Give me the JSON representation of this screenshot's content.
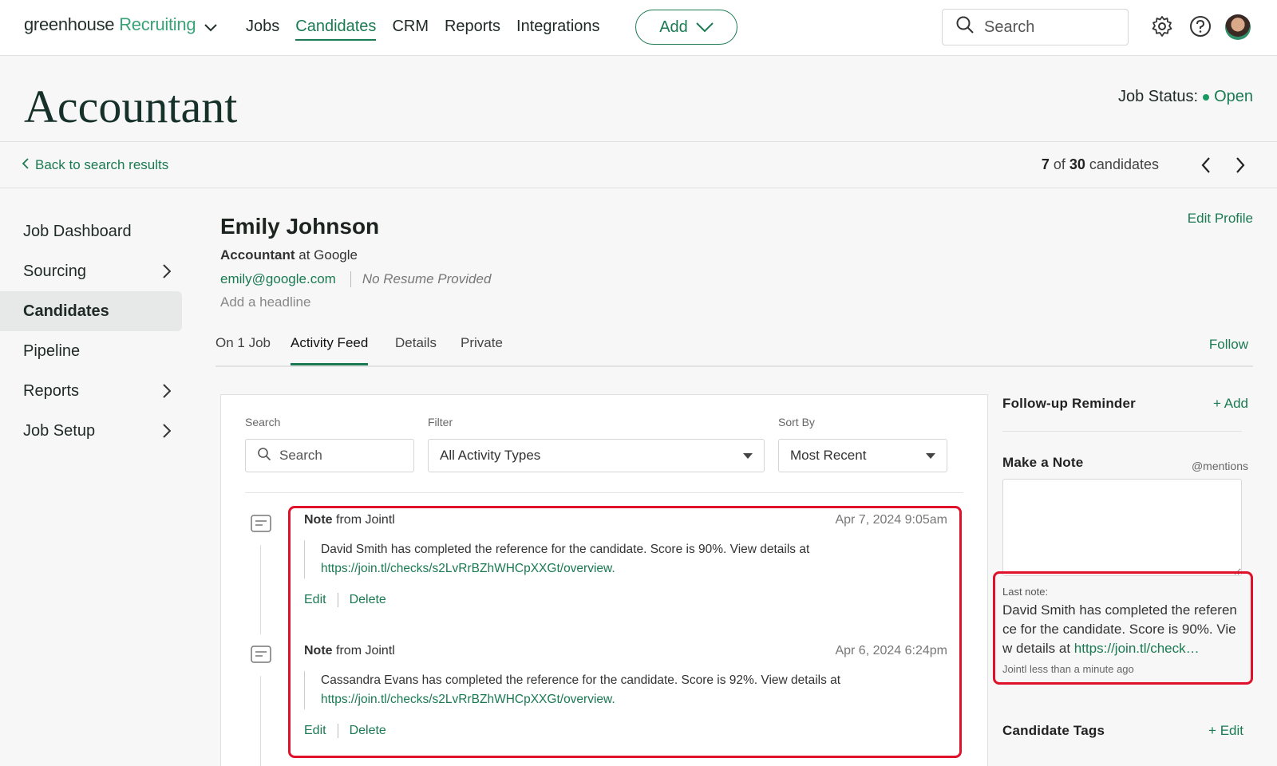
{
  "brand": {
    "name": "greenhouse",
    "product": "Recruiting"
  },
  "nav": {
    "items": [
      "Jobs",
      "Candidates",
      "CRM",
      "Reports",
      "Integrations"
    ],
    "active": "Candidates",
    "add_label": "Add"
  },
  "search": {
    "placeholder": "Search"
  },
  "page": {
    "title": "Accountant",
    "status_label": "Job Status:",
    "status_value": "Open"
  },
  "back": {
    "label": "Back to search results"
  },
  "pager": {
    "current": "7",
    "of": "of",
    "total": "30",
    "suffix": "candidates"
  },
  "sidebar": {
    "items": [
      {
        "label": "Job Dashboard"
      },
      {
        "label": "Sourcing"
      },
      {
        "label": "Candidates"
      },
      {
        "label": "Pipeline"
      },
      {
        "label": "Reports"
      },
      {
        "label": "Job Setup"
      }
    ]
  },
  "candidate": {
    "name": "Emily Johnson",
    "title": "Accountant",
    "at": "at Google",
    "email": "emily@google.com",
    "resume": "No Resume Provided",
    "headline_placeholder": "Add a headline",
    "edit_profile": "Edit Profile"
  },
  "tabs": {
    "items": [
      "On 1 Job",
      "Activity Feed",
      "Details",
      "Private"
    ],
    "active": "Activity Feed",
    "follow": "Follow"
  },
  "filters": {
    "search_label": "Search",
    "search_placeholder": "Search",
    "filter_label": "Filter",
    "filter_value": "All Activity Types",
    "sort_label": "Sort By",
    "sort_value": "Most Recent"
  },
  "notes": [
    {
      "type": "Note",
      "from": "from Jointl",
      "timestamp": "Apr 7, 2024 9:05am",
      "text": "David Smith has completed the reference for the candidate. Score is 90%. View details at",
      "link": "https://join.tl/checks/s2LvRrBZhWHCpXXGt/overview.",
      "edit": "Edit",
      "delete": "Delete"
    },
    {
      "type": "Note",
      "from": "from Jointl",
      "timestamp": "Apr 6, 2024 6:24pm",
      "text": "Cassandra Evans has completed the reference for the candidate. Score is 92%. View details at",
      "link": "https://join.tl/checks/s2LvRrBZhWHCpXXGt/overview.",
      "edit": "Edit",
      "delete": "Delete"
    }
  ],
  "right": {
    "followup_title": "Follow-up Reminder",
    "followup_add": "+ Add",
    "note_title": "Make a Note",
    "mentions": "@mentions",
    "last_note_label": "Last note:",
    "last_note_text": "David Smith has completed the reference for the candidate. Score is 90%. View details at",
    "last_note_link": "https://join.tl/check…",
    "last_note_meta": "Jointl less than a minute ago",
    "tags_title": "Candidate Tags",
    "tags_edit": "+ Edit"
  },
  "colors": {
    "accent": "#1a7a52",
    "highlight": "#e0112b"
  }
}
